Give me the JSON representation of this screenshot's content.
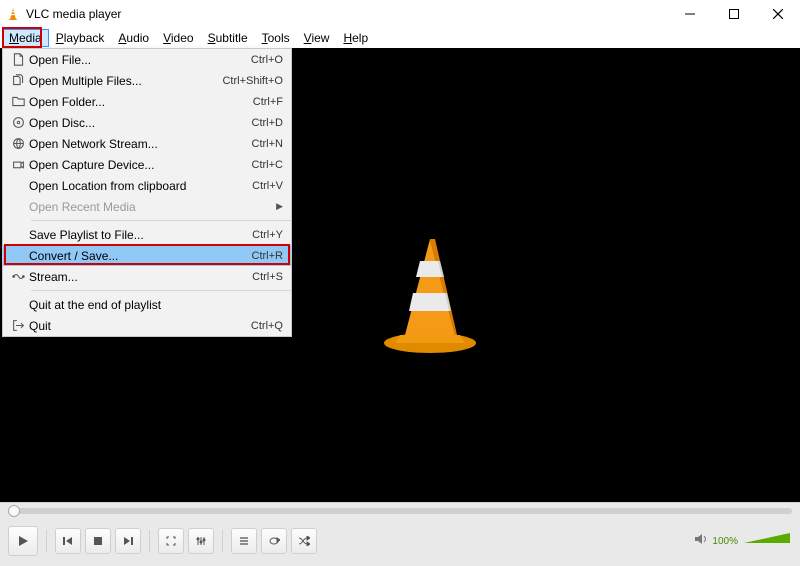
{
  "title": "VLC media player",
  "menubar": [
    {
      "label": "Media",
      "mn": "M",
      "open": true
    },
    {
      "label": "Playback",
      "mn": "P"
    },
    {
      "label": "Audio",
      "mn": "A"
    },
    {
      "label": "Video",
      "mn": "V"
    },
    {
      "label": "Subtitle",
      "mn": "S"
    },
    {
      "label": "Tools",
      "mn": "T"
    },
    {
      "label": "View",
      "mn": "Vi"
    },
    {
      "label": "Help",
      "mn": "H"
    }
  ],
  "dropdown": {
    "groups": [
      [
        {
          "icon": "file",
          "label": "Open File...",
          "mn": "F",
          "shortcut": "Ctrl+O"
        },
        {
          "icon": "files",
          "label": "Open Multiple Files...",
          "mn": "O",
          "shortcut": "Ctrl+Shift+O"
        },
        {
          "icon": "folder",
          "label": "Open Folder...",
          "mn": "F",
          "shortcut": "Ctrl+F"
        },
        {
          "icon": "disc",
          "label": "Open Disc...",
          "mn": "D",
          "shortcut": "Ctrl+D"
        },
        {
          "icon": "network",
          "label": "Open Network Stream...",
          "mn": "N",
          "shortcut": "Ctrl+N"
        },
        {
          "icon": "capture",
          "label": "Open Capture Device...",
          "mn": "C",
          "shortcut": "Ctrl+C"
        },
        {
          "icon": "",
          "label": "Open Location from clipboard",
          "mn": "",
          "shortcut": "Ctrl+V"
        },
        {
          "icon": "",
          "label": "Open Recent Media",
          "mn": "R",
          "shortcut": "",
          "disabled": true,
          "submenu": true
        }
      ],
      [
        {
          "icon": "",
          "label": "Save Playlist to File...",
          "mn": "F",
          "shortcut": "Ctrl+Y"
        },
        {
          "icon": "",
          "label": "Convert / Save...",
          "mn": "R",
          "shortcut": "Ctrl+R",
          "highlight": true,
          "redbox": true
        },
        {
          "icon": "stream",
          "label": "Stream...",
          "mn": "S",
          "shortcut": "Ctrl+S"
        }
      ],
      [
        {
          "icon": "",
          "label": "Quit at the end of playlist",
          "mn": "",
          "shortcut": ""
        },
        {
          "icon": "quit",
          "label": "Quit",
          "mn": "Q",
          "shortcut": "Ctrl+Q"
        }
      ]
    ]
  },
  "volume": {
    "percent": "100%"
  }
}
